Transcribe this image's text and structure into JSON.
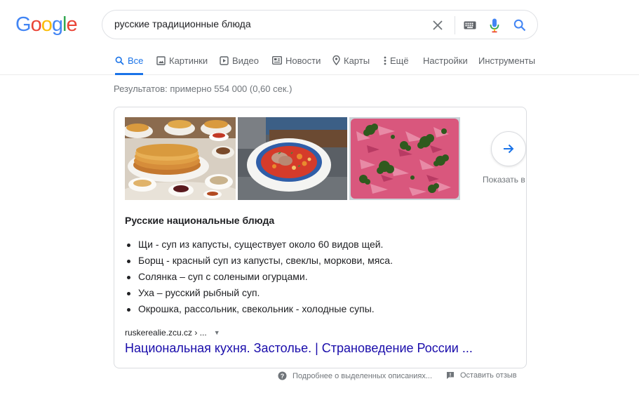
{
  "logo": {
    "letters": [
      "G",
      "o",
      "o",
      "g",
      "l",
      "e"
    ],
    "colors": [
      "#4285F4",
      "#EA4335",
      "#FBBC05",
      "#4285F4",
      "#34A853",
      "#EA4335"
    ]
  },
  "search": {
    "query": "русские традиционные блюда"
  },
  "tabs": [
    {
      "label": "Все",
      "icon": "search-icon",
      "active": true
    },
    {
      "label": "Картинки",
      "icon": "image-icon"
    },
    {
      "label": "Видео",
      "icon": "video-icon"
    },
    {
      "label": "Новости",
      "icon": "news-icon"
    },
    {
      "label": "Карты",
      "icon": "map-pin-icon"
    },
    {
      "label": "Ещё",
      "icon": "more-vert-icon"
    },
    {
      "label": "Настройки"
    },
    {
      "label": "Инструменты"
    }
  ],
  "results_count": "Результатов: примерно 554 000 (0,60 сек.)",
  "featured": {
    "more_images_label": "Показать в",
    "title": "Русские национальные блюда",
    "bullets": [
      "Щи - суп из капусты, существует около 60 видов щей.",
      "Борщ - красный суп из капусты, свеклы, моркови, мяса.",
      "Солянка – суп с солеными огурцами.",
      "Уха – русский рыбный суп.",
      "Окрошка, рассольник, свекольник - холодные супы."
    ],
    "cite": "ruskerealie.zcu.cz › ...",
    "link_title": "Национальная кухня. Застолье. | Страноведение России ..."
  },
  "footer": {
    "about": "Подробнее о выделенных описаниях...",
    "feedback": "Оставить отзыв"
  },
  "colors": {
    "accent": "#1a73e8",
    "link": "#1a0dab",
    "muted": "#70757a"
  }
}
